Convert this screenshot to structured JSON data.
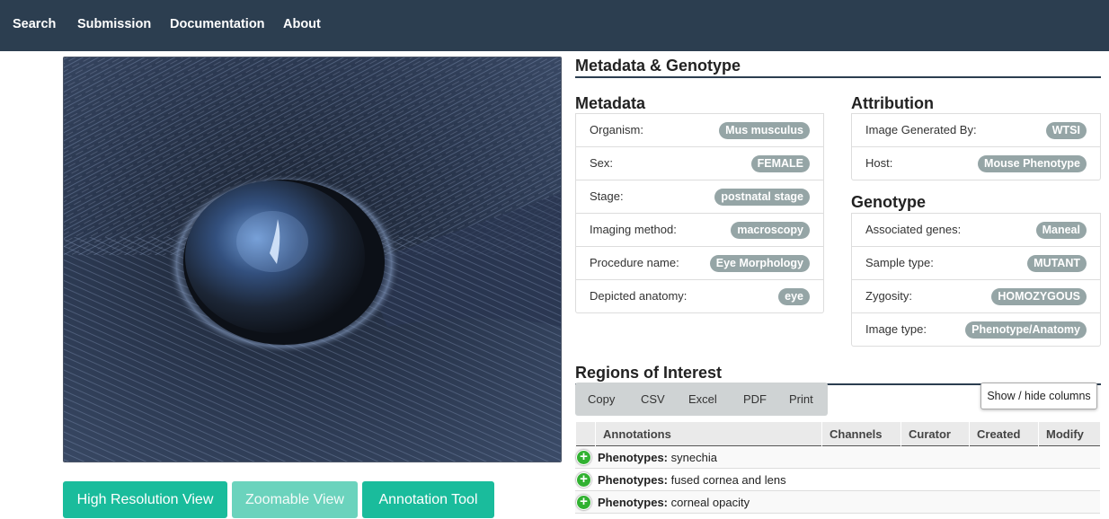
{
  "nav": {
    "items": [
      "Search",
      "Submission",
      "Documentation",
      "About"
    ]
  },
  "image": {
    "alt": "Mouse eye macroscopy image"
  },
  "buttons": {
    "high_res": "High Resolution View",
    "zoomable": "Zoomable View",
    "annotation": "Annotation Tool"
  },
  "headings": {
    "metadata_genotype": "Metadata & Genotype",
    "metadata": "Metadata",
    "attribution": "Attribution",
    "genotype": "Genotype",
    "regions": "Regions of Interest"
  },
  "metadata": [
    {
      "label": "Organism:",
      "value": "Mus musculus"
    },
    {
      "label": "Sex:",
      "value": "FEMALE"
    },
    {
      "label": "Stage:",
      "value": "postnatal stage"
    },
    {
      "label": "Imaging method:",
      "value": "macroscopy"
    },
    {
      "label": "Procedure name:",
      "value": "Eye Morphology"
    },
    {
      "label": "Depicted anatomy:",
      "value": "eye"
    }
  ],
  "attribution": [
    {
      "label": "Image Generated By:",
      "value": "WTSI"
    },
    {
      "label": "Host:",
      "value": "Mouse Phenotype"
    }
  ],
  "genotype": [
    {
      "label": "Associated genes:",
      "value": "Maneal"
    },
    {
      "label": "Sample type:",
      "value": "MUTANT"
    },
    {
      "label": "Zygosity:",
      "value": "HOMOZYGOUS"
    },
    {
      "label": "Image type:",
      "value": "Phenotype/Anatomy"
    }
  ],
  "toolbar": {
    "copy": "Copy",
    "csv": "CSV",
    "excel": "Excel",
    "pdf": "PDF",
    "print": "Print",
    "colvis": "Show / hide columns"
  },
  "table": {
    "columns": [
      "Annotations",
      "Channels",
      "Curator",
      "Created",
      "Modify"
    ],
    "rows": [
      {
        "key": "Phenotypes:",
        "value": "synechia"
      },
      {
        "key": "Phenotypes:",
        "value": "fused cornea and lens"
      },
      {
        "key": "Phenotypes:",
        "value": "corneal opacity"
      }
    ]
  },
  "colors": {
    "navbar": "#2c3e50",
    "accent": "#1abc9c",
    "badge": "#95a5a6",
    "add_icon": "#31b131"
  }
}
